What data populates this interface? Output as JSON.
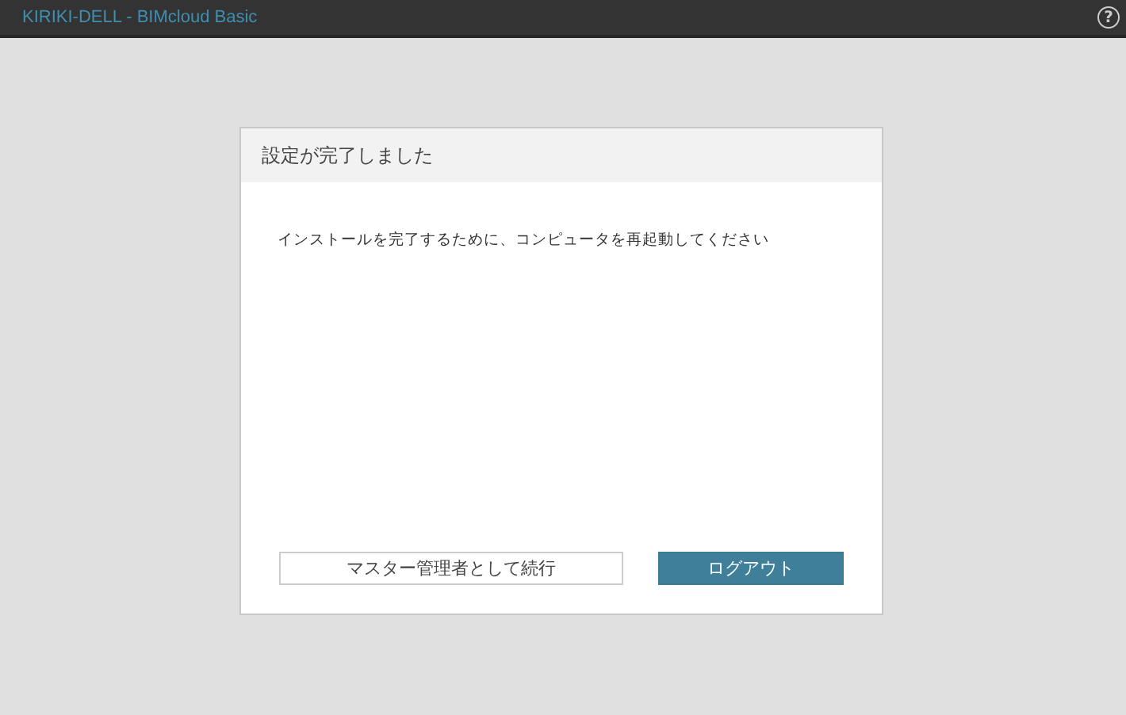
{
  "window": {
    "title": "KIRIKI-DELL - BIMcloud Basic",
    "help": "?"
  },
  "dialog": {
    "title": "設定が完了しました",
    "message": "インストールを完了するために、コンピュータを再起動してください",
    "buttons": [
      {
        "label": "マスター管理者として続行",
        "kind": "secondary"
      },
      {
        "label": "ログアウト",
        "kind": "primary"
      }
    ]
  }
}
